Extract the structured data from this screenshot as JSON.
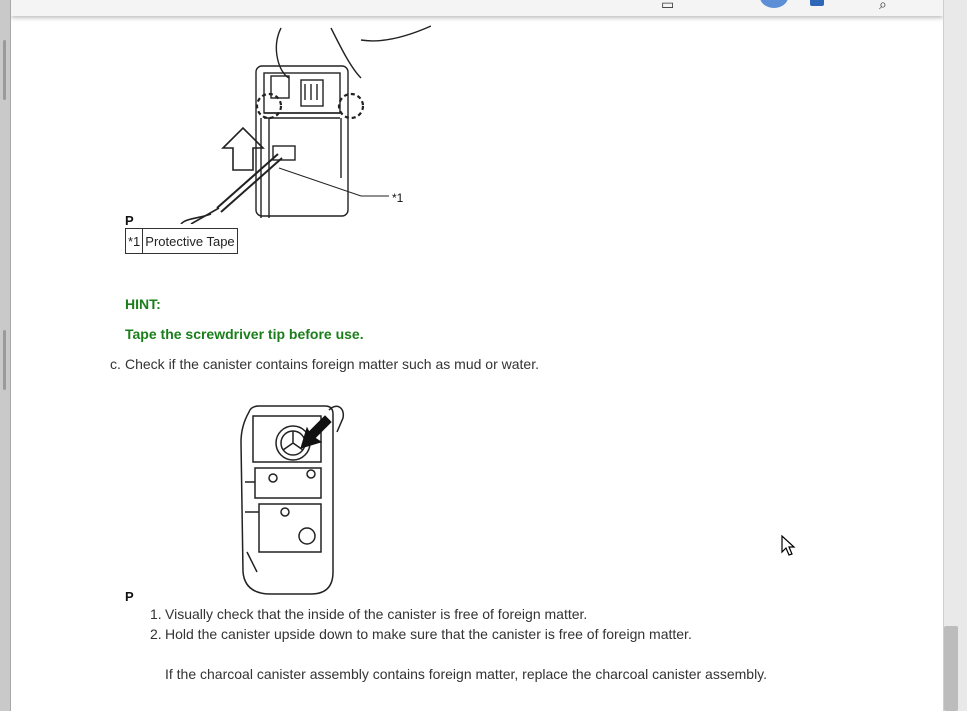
{
  "figure1": {
    "part_label": "P",
    "callout_marker": "*1"
  },
  "callout_table": {
    "code": "*1",
    "text": "Protective Tape"
  },
  "hint": {
    "title": "HINT:",
    "text": "Tape the screwdriver tip before use."
  },
  "step_c": {
    "marker": "c.",
    "text": "Check if the canister contains foreign matter such as mud or water."
  },
  "figure2": {
    "part_label": "P"
  },
  "substeps": [
    {
      "num": "1.",
      "text": "Visually check that the inside of the canister is free of foreign matter."
    },
    {
      "num": "2.",
      "text": "Hold the canister upside down to make sure that the canister is free of foreign matter."
    }
  ],
  "note": "If the charcoal canister assembly contains foreign matter, replace the charcoal canister assembly."
}
